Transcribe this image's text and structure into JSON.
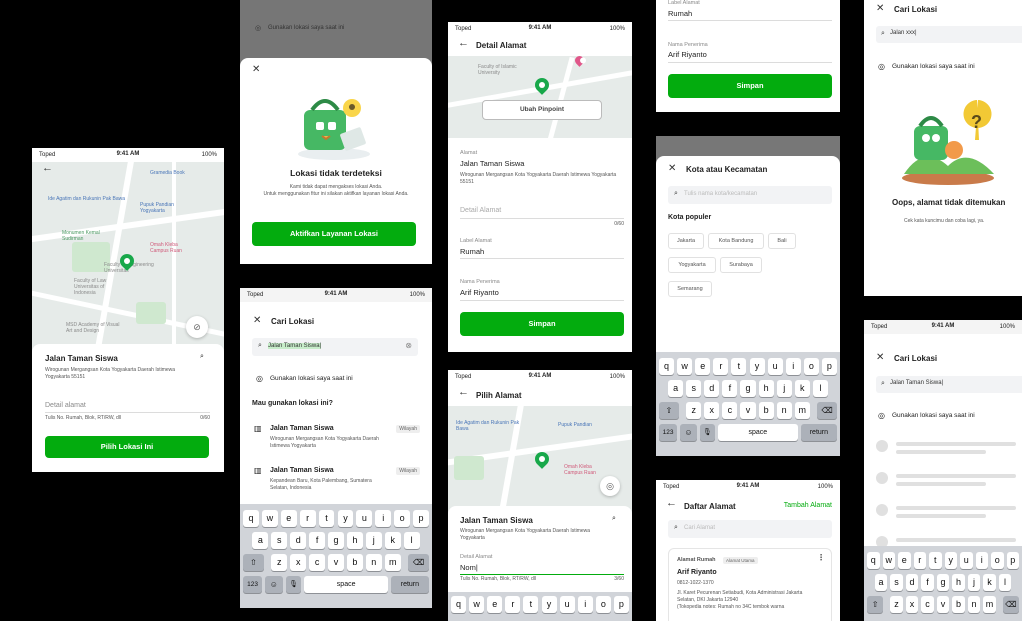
{
  "status": {
    "carrier": "Toped",
    "time": "9:41 AM",
    "battery": "100%"
  },
  "screen_a": {
    "pois": [
      "Gramedia Book",
      "Ide Agatim dan Rukunin Pak Bawa",
      "Pupuk Pandian Yogyakarta",
      "Monumen Kemal Sudirman",
      "Faculty of Engineering Universitas",
      "Omah Kleba Campus Ruan",
      "Faculty of Law Universitas of Indonesia",
      "MSD Academy of Visual Art and Design"
    ],
    "address_title": "Jalan Taman Siswa",
    "address_detail": "Wirogunan Mergangsan Kota Yogyakarta Daerah Istimewa Yogyakarta 55151",
    "detail_label": "Detail alamat",
    "detail_hint": "Tulis No. Rumah, Blok, RT/RW, dll",
    "detail_count": "0/60",
    "button": "Pilih Lokasi Ini"
  },
  "screen_b": {
    "top_text": "Gunakan lokasi saya saat ini",
    "title": "Lokasi tidak terdeteksi",
    "desc1": "Kami tidak dapat mengakses lokasi Anda.",
    "desc2": "Untuk menggunakan fitur ini silakan aktifkan layanan lokasi Anda.",
    "button": "Aktifkan Layanan Lokasi"
  },
  "screen_c": {
    "title": "Cari Lokasi",
    "query": "Jalan Taman Siswa|",
    "use_location": "Gunakan lokasi saya saat ini",
    "question": "Mau gunakan lokasi ini?",
    "results": [
      {
        "name": "Jalan Taman Siswa",
        "tag": "Wilayah",
        "addr": "Wirogunan Mergangsan Kota Yogyakarta Daerah Istimewa Yogyakarta"
      },
      {
        "name": "Jalan Taman Siswa",
        "tag": "Wilayah",
        "addr": "Kepandean Baru, Kota Palembang, Sumatera Selatan, Indonesia"
      }
    ]
  },
  "keyboard": {
    "row1": [
      "q",
      "w",
      "e",
      "r",
      "t",
      "y",
      "u",
      "i",
      "o",
      "p"
    ],
    "row2": [
      "a",
      "s",
      "d",
      "f",
      "g",
      "h",
      "j",
      "k",
      "l"
    ],
    "row3": [
      "z",
      "x",
      "c",
      "v",
      "b",
      "n",
      "m"
    ],
    "num": "123",
    "space": "space",
    "ret": "return"
  },
  "screen_d": {
    "header": "Detail Alamat",
    "pinpoint": "Ubah Pinpoint",
    "addr_label": "Alamat",
    "addr_title": "Jalan Taman Siswa",
    "addr_detail": "Wirogunan Mergangsan Kota Yogyakarta Daerah Istimewa Yogyakarta 55151",
    "detail_label": "Detail Alamat",
    "detail_count": "0/60",
    "label_label": "Label Alamat",
    "label_value": "Rumah",
    "recipient_label": "Nama Penerima",
    "recipient_value": "Arif Riyanto",
    "button": "Simpan"
  },
  "screen_e": {
    "header": "Pilih Alamat",
    "address_title": "Jalan Taman Siswa",
    "address_detail": "Wirogunan Mergangsan Kota Yogyakarta Daerah Istimewa Yogyakarta",
    "detail_label": "Detail Alamat",
    "detail_value": "Nom|",
    "detail_hint": "Tulis No. Rumah, Blok, RT/RW, dll",
    "detail_count": "3/60"
  },
  "screen_f": {
    "label_label": "Label Alamat",
    "label_value": "Rumah",
    "recipient_label": "Nama Penerima",
    "recipient_value": "Arif Riyanto",
    "button": "Simpan"
  },
  "screen_g": {
    "title": "Kota atau Kecamatan",
    "placeholder": "Tulis nama kota/kecamatan",
    "popular": "Kota populer",
    "cities": [
      "Jakarta",
      "Kota Bandung",
      "Bali",
      "Yogyakarta",
      "Surabaya",
      "Semarang"
    ]
  },
  "screen_h": {
    "header": "Daftar Alamat",
    "add": "Tambah Alamat",
    "search_placeholder": "Cari Alamat",
    "card_label": "Alamat Rumah",
    "card_badge": "Alamat Utama",
    "card_name": "Arif Riyanto",
    "card_phone": "0812-1022-1370",
    "card_addr": "Jl. Karet Pecurenan Setiabudi, Kota Administrasi Jakarta Selatan, DKI Jakarta 12940",
    "card_note": "(Tokopedia notes: Rumah no 34C tembok warna"
  },
  "screen_i": {
    "title": "Cari Lokasi",
    "query": "Jalan xxx|",
    "use_location": "Gunakan lokasi saya saat ini",
    "empty_title": "Oops, alamat tidak ditemukan",
    "empty_desc": "Cek kata kuncimu dan coba lagi, ya."
  },
  "screen_j": {
    "title": "Cari Lokasi",
    "query": "Jalan Taman Siswa|",
    "use_location": "Gunakan lokasi saya saat ini"
  },
  "colors": {
    "primary": "#03ac0e",
    "pin": "#18a84a"
  }
}
